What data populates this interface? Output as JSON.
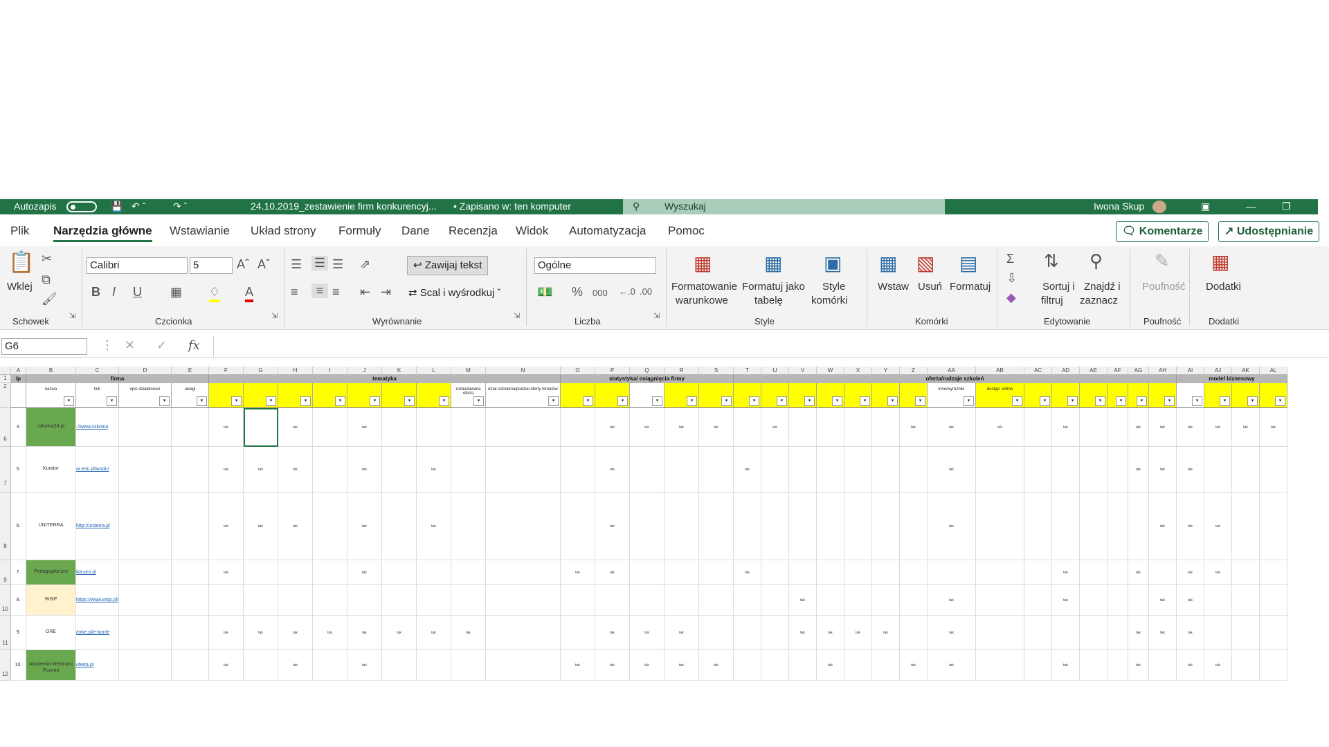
{
  "titlebar": {
    "autosave": "Autozapis",
    "filename": "24.10.2019_zestawienie firm konkurencyj...",
    "saved": "• Zapisano w: ten komputer",
    "search_placeholder": "Wyszukaj",
    "user": "Iwona Skup"
  },
  "menu": {
    "tabs": [
      "Plik",
      "Narzędzia główne",
      "Wstawianie",
      "Układ strony",
      "Formuły",
      "Dane",
      "Recenzja",
      "Widok",
      "Automatyzacja",
      "Pomoc"
    ],
    "comments": "Komentarze",
    "share": "Udostępnianie"
  },
  "ribbon": {
    "clipboard": {
      "paste": "Wklej",
      "group": "Schowek"
    },
    "font": {
      "name": "Calibri",
      "size": "5",
      "bold": "B",
      "italic": "I",
      "underline": "U",
      "group": "Czcionka"
    },
    "alignment": {
      "wrap": "Zawijaj tekst",
      "merge": "Scal i wyśrodkuj",
      "group": "Wyrównanie"
    },
    "number": {
      "format": "Ogólne",
      "percent": "%",
      "thousands": "000",
      "group": "Liczba"
    },
    "styles": {
      "conditional_1": "Formatowanie",
      "conditional_2": "warunkowe",
      "table_1": "Formatuj jako",
      "table_2": "tabelę",
      "cell_1": "Style",
      "cell_2": "komórki",
      "group": "Style"
    },
    "cells": {
      "insert": "Wstaw",
      "delete": "Usuń",
      "format": "Formatuj",
      "group": "Komórki"
    },
    "editing": {
      "sort_1": "Sortuj i",
      "sort_2": "filtruj",
      "find_1": "Znajdź i",
      "find_2": "zaznacz",
      "group": "Edytowanie"
    },
    "sensitivity": {
      "label": "Poufność",
      "group": "Poufność"
    },
    "addins": {
      "label": "Dodatki",
      "group": "Dodatki"
    }
  },
  "formula_bar": {
    "cell_ref": "G6",
    "fx": "fx",
    "value": ""
  },
  "sheet": {
    "columns": [
      "A",
      "B",
      "C",
      "D",
      "E",
      "F",
      "G",
      "H",
      "I",
      "J",
      "K",
      "L",
      "M",
      "N",
      "O",
      "P",
      "Q",
      "R",
      "S",
      "T",
      "U",
      "V",
      "W",
      "X",
      "Y",
      "Z",
      "AA",
      "AB",
      "AC",
      "AD",
      "AE",
      "AF",
      "AG",
      "AH",
      "AI",
      "AJ",
      "AK",
      "AL"
    ],
    "group_headers": {
      "lp": "lp",
      "firma": "firma",
      "tematyka": "tematyka",
      "statystyka": "statystyka/ osiągnięcia firmy",
      "oferta": "oferta/rodzaje szkoleń",
      "model": "model biznesowy"
    },
    "subheaders": {
      "nazwa": "nazwa",
      "link": "link",
      "opis": "opis działalności",
      "uwagi": "uwagi",
      "rozbudowana": "rozbudowana oferta",
      "dzial": "dział szkolenia/podział oferty tematów",
      "inne": "inne/wyróżniki",
      "dostep": "dostęp: online"
    },
    "rows": [
      {
        "lp": "4.",
        "name": "szkolna24.pl",
        "link": "://www.szkolna",
        "rownum": "6"
      },
      {
        "lp": "5.",
        "name": "Kurator",
        "link": "ar.edu.pl/wodn/",
        "rownum": "7"
      },
      {
        "lp": "6.",
        "name": "UNITERRA",
        "link": "http://uniterra.pl",
        "rownum": "8"
      },
      {
        "lp": "7.",
        "name": "Pedagogika pro",
        "link": "ika-pro.pl",
        "rownum": "9"
      },
      {
        "lp": "8.",
        "name": "WSiP",
        "link": "https://www.wsip.pl/",
        "rownum": "10"
      },
      {
        "lp": "9.",
        "name": "ORE",
        "link": "/orke.pl/e-konfe",
        "rownum": "11"
      },
      {
        "lp": "10.",
        "name": "Akademia Webinaru Poznań",
        "link": "oferta.pl",
        "rownum": "12"
      }
    ],
    "cell_mark": "tak",
    "colors": {
      "header_gray": "#b7b7b7",
      "yellow": "#ffff00",
      "green": "#6aa84f",
      "cream": "#fff2cc",
      "excel_green": "#217346"
    }
  }
}
